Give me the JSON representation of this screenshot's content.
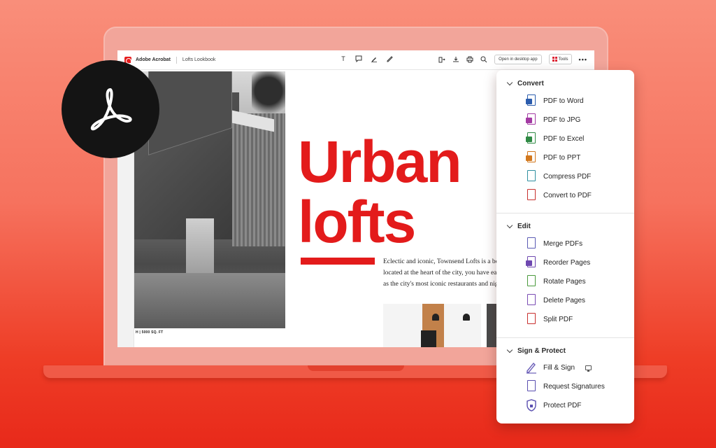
{
  "app": {
    "name": "Adobe Acrobat",
    "document": "Lofts Lookbook",
    "open_desktop_label": "Open in desktop app",
    "tools_label": "Tools",
    "more_label": "•••"
  },
  "document": {
    "headline_line1": "Urban",
    "headline_line2": "lofts",
    "body_lines": [
      "Eclectic and iconic, Townsend Lofts is a bold",
      "located at the heart of the city, you have easy a",
      "as the city's most iconic restaurants and nightl"
    ],
    "photo_caption": "H | 5000 SQ. FT"
  },
  "panel": {
    "sections": [
      {
        "title": "Convert",
        "items": [
          {
            "label": "PDF to Word",
            "icon": "word-icon",
            "color": "#2b5cad"
          },
          {
            "label": "PDF to JPG",
            "icon": "jpg-icon",
            "color": "#a33aa3"
          },
          {
            "label": "PDF to Excel",
            "icon": "excel-icon",
            "color": "#2f8a44"
          },
          {
            "label": "PDF to PPT",
            "icon": "ppt-icon",
            "color": "#d2781e"
          },
          {
            "label": "Compress PDF",
            "icon": "compress-icon",
            "color": "#2f8fa0"
          },
          {
            "label": "Convert to PDF",
            "icon": "convert-pdf-icon",
            "color": "#c8302e"
          }
        ]
      },
      {
        "title": "Edit",
        "items": [
          {
            "label": "Merge PDFs",
            "icon": "merge-icon",
            "color": "#5a5ab4"
          },
          {
            "label": "Reorder Pages",
            "icon": "reorder-icon",
            "color": "#6e48b0"
          },
          {
            "label": "Rotate Pages",
            "icon": "rotate-icon",
            "color": "#4a9a3c"
          },
          {
            "label": "Delete Pages",
            "icon": "delete-icon",
            "color": "#7a4cb4"
          },
          {
            "label": "Split PDF",
            "icon": "split-icon",
            "color": "#c8302e"
          }
        ]
      },
      {
        "title": "Sign & Protect",
        "items": [
          {
            "label": "Fill & Sign",
            "icon": "fill-sign-icon",
            "color": "#6b5fb8"
          },
          {
            "label": "Request Signatures",
            "icon": "request-signatures-icon",
            "color": "#5a4fb0"
          },
          {
            "label": "Protect PDF",
            "icon": "protect-icon",
            "color": "#5a4fb0"
          }
        ]
      }
    ]
  },
  "colors": {
    "accent_red": "#e31b1b",
    "background": "#f6725e"
  }
}
